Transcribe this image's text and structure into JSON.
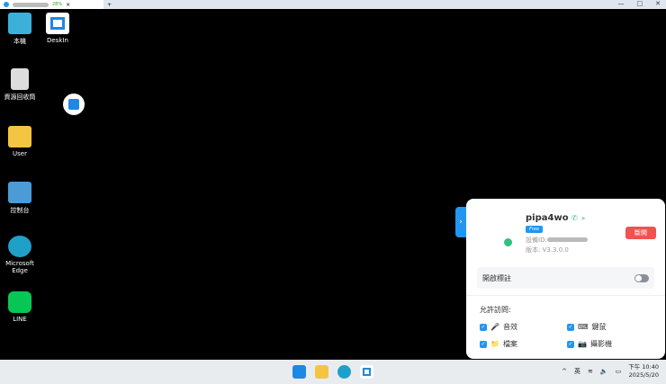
{
  "browser": {
    "tab_close": "×",
    "new_tab": "+",
    "signal": "28%"
  },
  "desktop": {
    "icons": [
      {
        "label": "本機"
      },
      {
        "label": "DeskIn"
      },
      {
        "label": "資源回收筒"
      },
      {
        "label": "User"
      },
      {
        "label": "控制台"
      },
      {
        "label": "Microsoft Edge"
      },
      {
        "label": "LINE"
      }
    ]
  },
  "panel": {
    "handle": "›",
    "name": "pipa4wo",
    "badge": "Free",
    "device_id_label": "設備ID:",
    "version": "版本: V3.3.0.0",
    "disconnect": "斷開",
    "annotation_label": "開啟標註",
    "allow_title": "允許訪問:",
    "permissions": [
      {
        "label": "音效",
        "icon": "🎤"
      },
      {
        "label": "鍵鼠",
        "icon": "⌨"
      },
      {
        "label": "檔案",
        "icon": "📁"
      },
      {
        "label": "攝影機",
        "icon": "📷"
      }
    ]
  },
  "tray": {
    "chevron": "^",
    "ime": "英",
    "time": "下午 10:40",
    "date": "2025/5/20"
  }
}
